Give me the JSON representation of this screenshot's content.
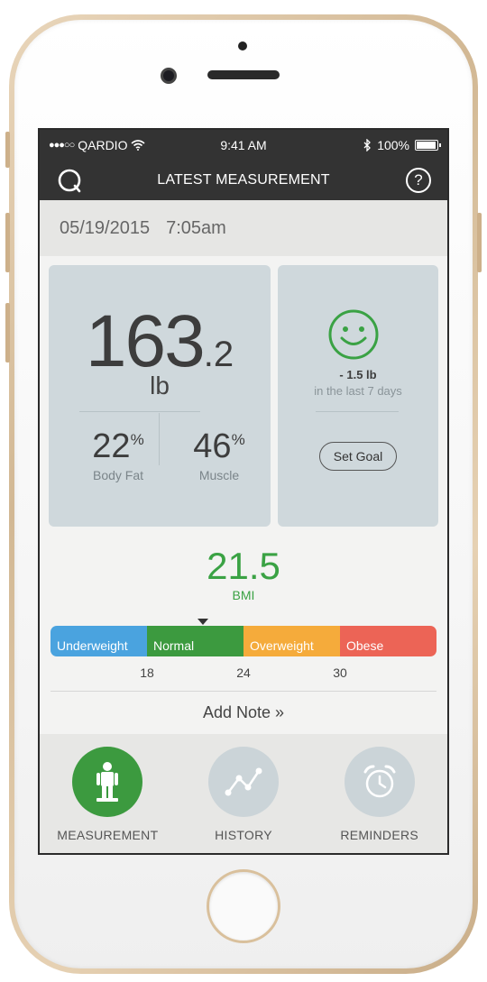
{
  "status_bar": {
    "carrier": "QARDIO",
    "time": "9:41 AM",
    "battery": "100%",
    "battery_level": 1.0
  },
  "nav": {
    "title": "LATEST MEASUREMENT",
    "help_symbol": "?",
    "logo_icon": "qardio-logo-icon",
    "help_icon": "help-icon"
  },
  "measurement": {
    "date": "05/19/2015",
    "time": "7:05am",
    "weight_int": "163",
    "weight_dec": ".2",
    "weight_unit": "lb",
    "body_fat_value": "22",
    "body_fat_unit": "%",
    "body_fat_label": "Body Fat",
    "muscle_value": "46",
    "muscle_unit": "%",
    "muscle_label": "Muscle"
  },
  "goal": {
    "icon": "smiley-face-icon",
    "trend": "- 1.5 lb",
    "trend_period": "in the last 7 days",
    "set_goal_label": "Set Goal"
  },
  "bmi": {
    "value": "21.5",
    "value_number": 21.5,
    "label": "BMI",
    "scale_min": 12,
    "scale_max": 36,
    "segments": [
      {
        "label": "Underweight",
        "color": "#4aa3df"
      },
      {
        "label": "Normal",
        "color": "#3c9a3f"
      },
      {
        "label": "Overweight",
        "color": "#f5ab3b"
      },
      {
        "label": "Obese",
        "color": "#ec6456"
      }
    ],
    "ticks": [
      "18",
      "24",
      "30"
    ]
  },
  "add_note_label": "Add Note »",
  "tabs": [
    {
      "label": "MEASUREMENT",
      "icon": "person-scale-icon",
      "active": true
    },
    {
      "label": "HISTORY",
      "icon": "line-chart-icon",
      "active": false
    },
    {
      "label": "REMINDERS",
      "icon": "alarm-clock-icon",
      "active": false
    }
  ],
  "colors": {
    "accent_green": "#3aa244",
    "card_bg": "#cfd8dc",
    "header_bg": "#333333"
  }
}
